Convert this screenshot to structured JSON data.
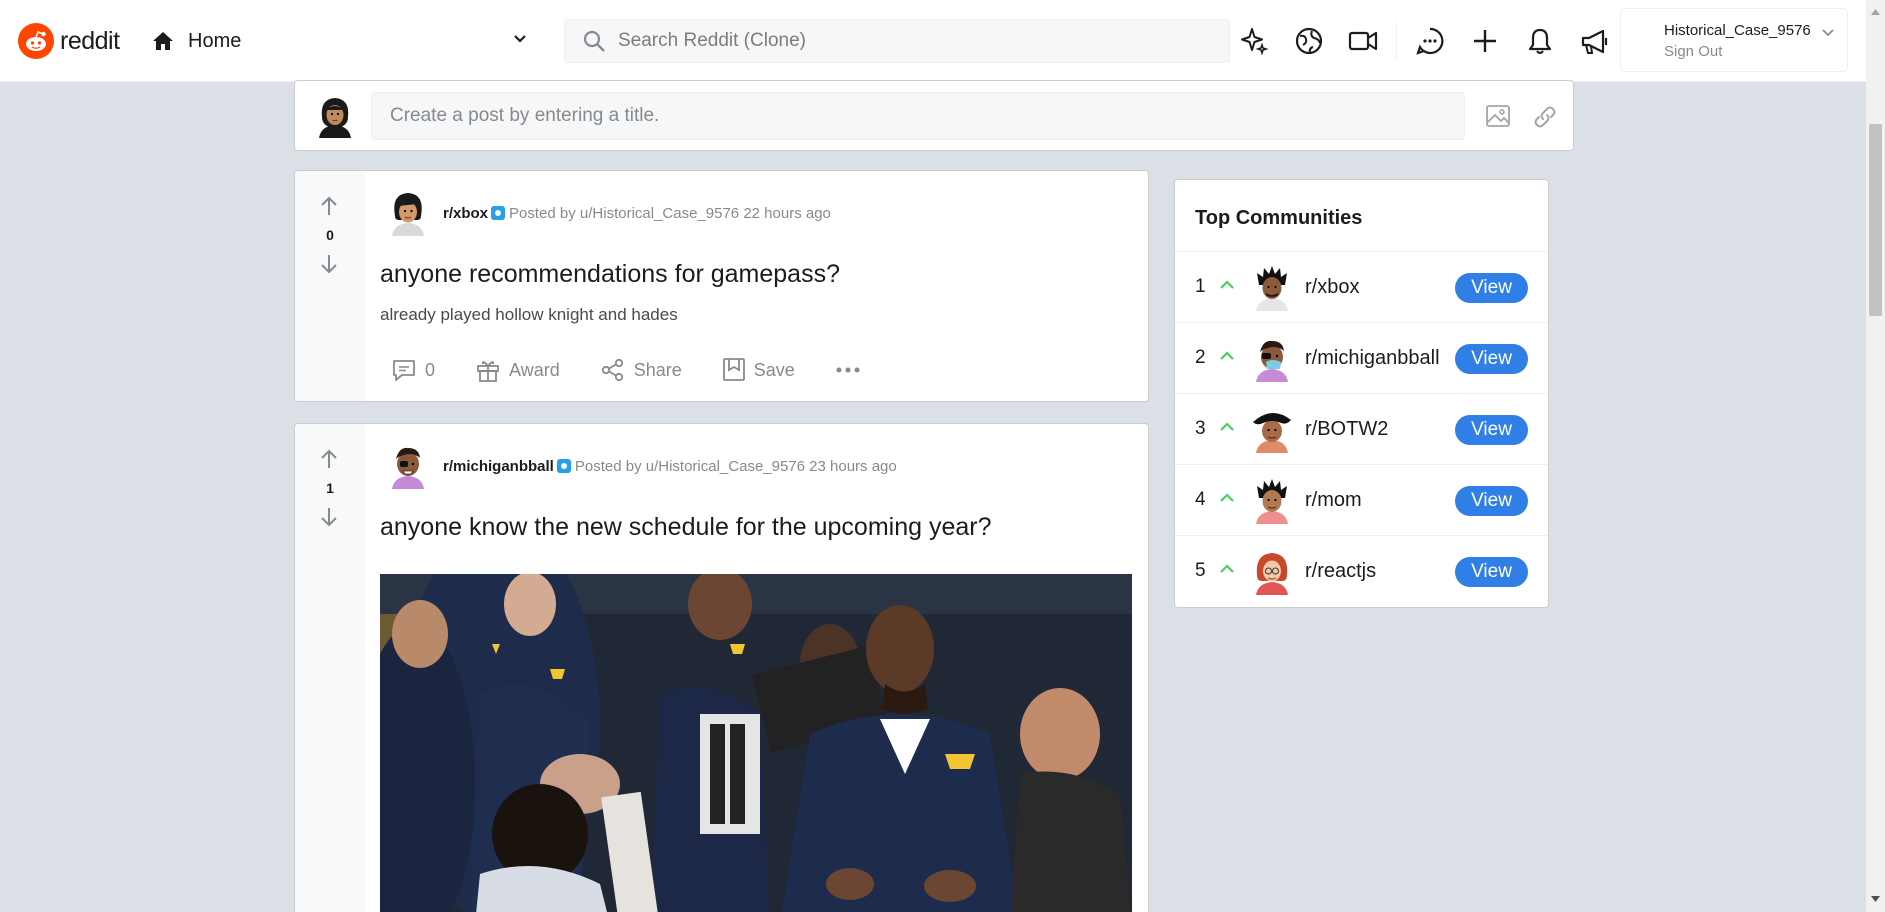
{
  "header": {
    "logo_text": "reddit",
    "home_label": "Home",
    "search_placeholder": "Search Reddit (Clone)",
    "user": {
      "name": "Historical_Case_9576",
      "action": "Sign Out"
    }
  },
  "create_post": {
    "placeholder": "Create a post by entering a title."
  },
  "posts": [
    {
      "subreddit": "r/xbox",
      "posted_by": "Posted by u/Historical_Case_9576 22 hours ago",
      "score": "0",
      "title": "anyone recommendations for gamepass?",
      "body": "already played hollow knight and hades",
      "comments": "0",
      "award": "Award",
      "share": "Share",
      "save": "Save"
    },
    {
      "subreddit": "r/michiganbball",
      "posted_by": "Posted by u/Historical_Case_9576 23 hours ago",
      "score": "1",
      "title": "anyone know the new schedule for the upcoming year?"
    }
  ],
  "sidebar": {
    "title": "Top Communities",
    "view_label": "View",
    "communities": [
      {
        "rank": "1",
        "name": "r/xbox"
      },
      {
        "rank": "2",
        "name": "r/michiganbball"
      },
      {
        "rank": "3",
        "name": "r/BOTW2"
      },
      {
        "rank": "4",
        "name": "r/mom"
      },
      {
        "rank": "5",
        "name": "r/reactjs"
      }
    ]
  },
  "colors": {
    "brand": "#ff4500",
    "accent": "#2f7fe6",
    "up_caret": "#46d160",
    "background": "#dae0e6"
  }
}
